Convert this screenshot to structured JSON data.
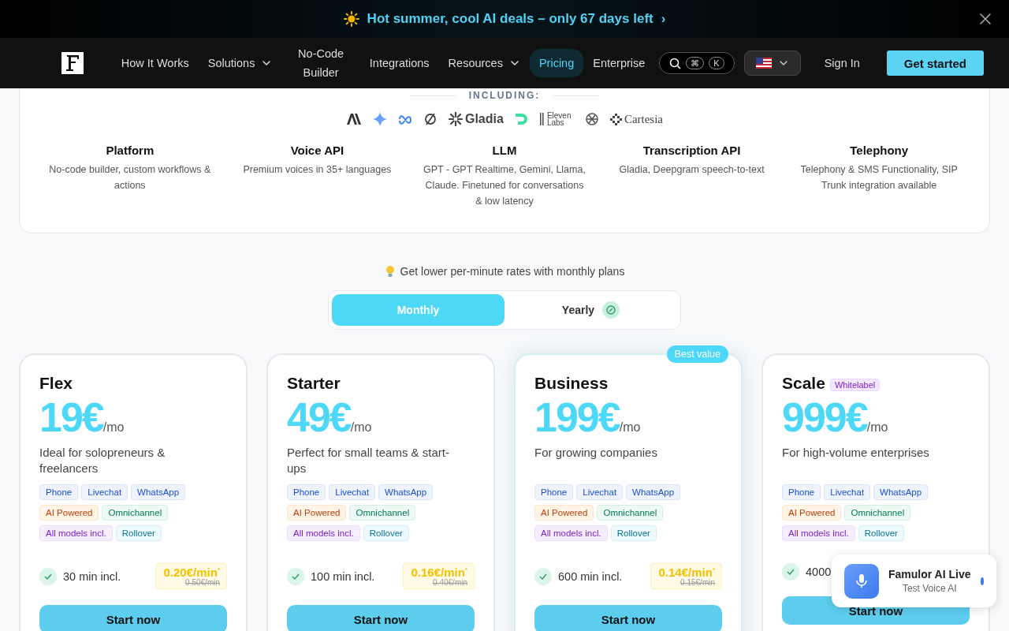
{
  "banner": {
    "text": "Hot summer, cool AI deals – only 67 days left",
    "arrow": "›"
  },
  "nav": {
    "items": [
      {
        "label": "How It Works",
        "dropdown": false,
        "selected": false
      },
      {
        "label": "Solutions",
        "dropdown": true,
        "selected": false
      },
      {
        "label": "No-Code Builder",
        "dropdown": false,
        "selected": false
      },
      {
        "label": "Integrations",
        "dropdown": false,
        "selected": false
      },
      {
        "label": "Resources",
        "dropdown": true,
        "selected": false
      },
      {
        "label": "Pricing",
        "dropdown": false,
        "selected": true
      },
      {
        "label": "Enterprise",
        "dropdown": false,
        "selected": false
      }
    ],
    "search_keys": [
      "⌘",
      "K"
    ],
    "sign_in": "Sign In",
    "cta": "Get started"
  },
  "platform": {
    "heading": "INCLUDING:",
    "logos": [
      {
        "kind": "anthropic"
      },
      {
        "kind": "gemini"
      },
      {
        "kind": "meta"
      },
      {
        "kind": "slashed"
      },
      {
        "kind": "gladia",
        "text": "Gladia"
      },
      {
        "kind": "deepgram"
      },
      {
        "kind": "elevenlabs",
        "text": "Eleven Labs"
      },
      {
        "kind": "openai"
      },
      {
        "kind": "cartesia",
        "text": "Cartesia"
      }
    ],
    "features": [
      {
        "title": "Platform",
        "text": "No-code builder, custom workflows & actions"
      },
      {
        "title": "Voice API",
        "text": "Premium voices in 35+ languages"
      },
      {
        "title": "LLM",
        "text": "GPT - GPT Realtime, Gemini, Llama, Claude. Finetuned for conversations & low latency"
      },
      {
        "title": "Transcription API",
        "text": "Gladia, Deepgram speech-to-text"
      },
      {
        "title": "Telephony",
        "text": "Telephony & SMS Functionality, SIP Trunk integration available"
      }
    ]
  },
  "billing": {
    "tip": "Get lower per-minute rates with monthly plans",
    "options": [
      {
        "label": "Monthly",
        "selected": true
      },
      {
        "label": "Yearly",
        "selected": false
      }
    ]
  },
  "plans": [
    {
      "name": "Flex",
      "price": "19€",
      "period": "/mo",
      "description": "Ideal for solopreneurs & freelancers",
      "tags": [
        {
          "label": "Phone",
          "kind": "channel"
        },
        {
          "label": "Livechat",
          "kind": "channel"
        },
        {
          "label": "WhatsApp",
          "kind": "channel"
        },
        {
          "label": "AI Powered",
          "kind": "ai"
        },
        {
          "label": "Omnichannel",
          "kind": "omni"
        },
        {
          "label": "All models incl.",
          "kind": "models"
        },
        {
          "label": "Rollover",
          "kind": "rollover"
        }
      ],
      "minutes": "30 min incl.",
      "rate": "0.20€/min",
      "rate_mark": "*",
      "old_rate": "0.50€/min",
      "button": "Start now"
    },
    {
      "name": "Starter",
      "price": "49€",
      "period": "/mo",
      "description": "Perfect for small teams & start-ups",
      "tags": [
        {
          "label": "Phone",
          "kind": "channel"
        },
        {
          "label": "Livechat",
          "kind": "channel"
        },
        {
          "label": "WhatsApp",
          "kind": "channel"
        },
        {
          "label": "AI Powered",
          "kind": "ai"
        },
        {
          "label": "Omnichannel",
          "kind": "omni"
        },
        {
          "label": "All models incl.",
          "kind": "models"
        },
        {
          "label": "Rollover",
          "kind": "rollover"
        }
      ],
      "minutes": "100 min incl.",
      "rate": "0.16€/min",
      "rate_mark": "*",
      "old_rate": "0.40€/min",
      "button": "Start now"
    },
    {
      "name": "Business",
      "ribbon": "Best value",
      "price": "199€",
      "period": "/mo",
      "description": "For growing companies",
      "tags": [
        {
          "label": "Phone",
          "kind": "channel"
        },
        {
          "label": "Livechat",
          "kind": "channel"
        },
        {
          "label": "WhatsApp",
          "kind": "channel"
        },
        {
          "label": "AI Powered",
          "kind": "ai"
        },
        {
          "label": "Omnichannel",
          "kind": "omni"
        },
        {
          "label": "All models incl.",
          "kind": "models"
        },
        {
          "label": "Rollover",
          "kind": "rollover"
        }
      ],
      "minutes": "600 min incl.",
      "rate": "0.14€/min",
      "rate_mark": "*",
      "old_rate": "0.15€/min",
      "button": "Start now"
    },
    {
      "name": "Scale",
      "badge": "Whitelabel",
      "price": "999€",
      "period": "/mo",
      "description": "For high-volume enterprises",
      "tags": [
        {
          "label": "Phone",
          "kind": "channel"
        },
        {
          "label": "Livechat",
          "kind": "channel"
        },
        {
          "label": "WhatsApp",
          "kind": "channel"
        },
        {
          "label": "AI Powered",
          "kind": "ai"
        },
        {
          "label": "Omnichannel",
          "kind": "omni"
        },
        {
          "label": "All models incl.",
          "kind": "models"
        },
        {
          "label": "Rollover",
          "kind": "rollover"
        }
      ],
      "minutes": "4000",
      "button": "Start now"
    }
  ],
  "widget": {
    "title": "Famulor AI Live",
    "subtitle": "Test Voice AI"
  }
}
